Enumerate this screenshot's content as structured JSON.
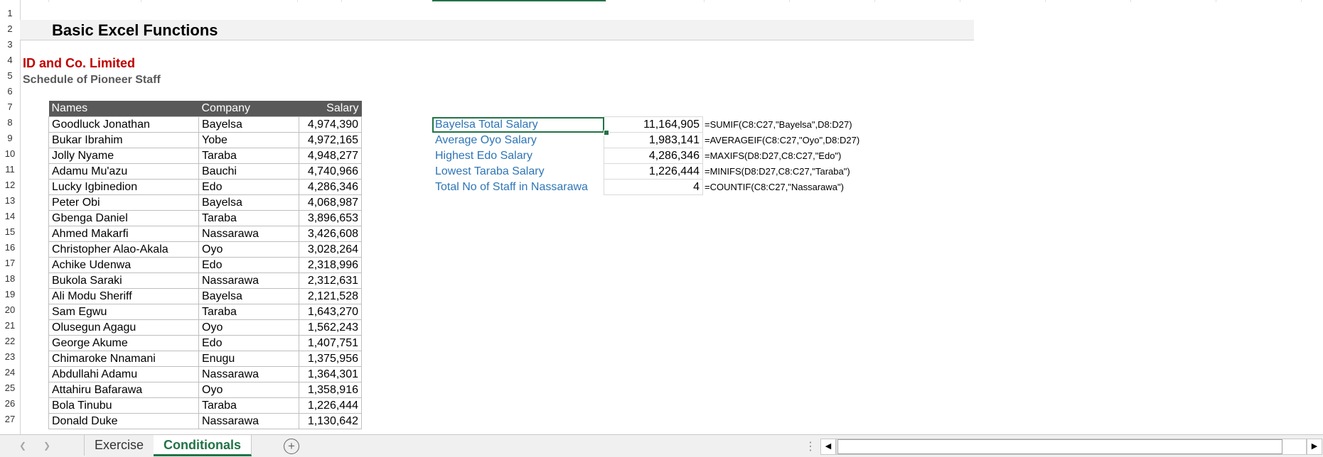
{
  "sheet": {
    "title": "Basic Excel Functions",
    "company": "ID and Co. Limited",
    "subtitle": "Schedule of Pioneer Staff",
    "row_numbers": [
      "1",
      "2",
      "3",
      "4",
      "5",
      "6",
      "7",
      "8",
      "9",
      "10",
      "11",
      "12",
      "13",
      "14",
      "15",
      "16",
      "17",
      "18",
      "19",
      "20",
      "21",
      "22",
      "23",
      "24",
      "25",
      "26",
      "27"
    ]
  },
  "staff_table": {
    "headers": [
      "Names",
      "Company",
      "Salary"
    ],
    "rows": [
      [
        "Goodluck Jonathan",
        "Bayelsa",
        "4,974,390"
      ],
      [
        "Bukar Ibrahim",
        "Yobe",
        "4,972,165"
      ],
      [
        "Jolly Nyame",
        "Taraba",
        "4,948,277"
      ],
      [
        "Adamu Mu'azu",
        "Bauchi",
        "4,740,966"
      ],
      [
        "Lucky Igbinedion",
        "Edo",
        "4,286,346"
      ],
      [
        "Peter Obi",
        "Bayelsa",
        "4,068,987"
      ],
      [
        "Gbenga Daniel",
        "Taraba",
        "3,896,653"
      ],
      [
        "Ahmed Makarfi",
        "Nassarawa",
        "3,426,608"
      ],
      [
        "Christopher Alao-Akala",
        "Oyo",
        "3,028,264"
      ],
      [
        "Achike Udenwa",
        "Edo",
        "2,318,996"
      ],
      [
        "Bukola Saraki",
        "Nassarawa",
        "2,312,631"
      ],
      [
        "Ali Modu Sheriff",
        "Bayelsa",
        "2,121,528"
      ],
      [
        "Sam Egwu",
        "Taraba",
        "1,643,270"
      ],
      [
        "Olusegun Agagu",
        "Oyo",
        "1,562,243"
      ],
      [
        "George Akume",
        "Edo",
        "1,407,751"
      ],
      [
        "Chimaroke Nnamani",
        "Enugu",
        "1,375,956"
      ],
      [
        "Abdullahi Adamu",
        "Nassarawa",
        "1,364,301"
      ],
      [
        "Attahiru Bafarawa",
        "Oyo",
        "1,358,916"
      ],
      [
        "Bola Tinubu",
        "Taraba",
        "1,226,444"
      ],
      [
        "Donald Duke",
        "Nassarawa",
        "1,130,642"
      ]
    ]
  },
  "summary": [
    {
      "label": "Bayelsa Total Salary",
      "value": "11,164,905",
      "formula": "=SUMIF(C8:C27,\"Bayelsa\",D8:D27)"
    },
    {
      "label": "Average Oyo Salary",
      "value": "1,983,141",
      "formula": "=AVERAGEIF(C8:C27,\"Oyo\",D8:D27)"
    },
    {
      "label": "Highest Edo Salary",
      "value": "4,286,346",
      "formula": "=MAXIFS(D8:D27,C8:C27,\"Edo\")"
    },
    {
      "label": "Lowest Taraba Salary",
      "value": "1,226,444",
      "formula": "=MINIFS(D8:D27,C8:C27,\"Taraba\")"
    },
    {
      "label": "Total No of Staff in Nassarawa",
      "value": "4",
      "formula": "=COUNTIF(C8:C27,\"Nassarawa\")"
    }
  ],
  "tabs": {
    "items": [
      "Exercise",
      "Conditionals"
    ],
    "active": "Conditionals"
  },
  "icons": {
    "prev_sheet": "chevron-left-icon",
    "next_sheet": "chevron-right-icon",
    "add_sheet": "plus-circle-icon",
    "scroll_left": "triangle-left-icon",
    "scroll_right": "triangle-right-icon"
  },
  "colors": {
    "header_bg": "#595959",
    "company_red": "#c00000",
    "label_blue": "#2e75b6",
    "excel_green": "#217346"
  }
}
